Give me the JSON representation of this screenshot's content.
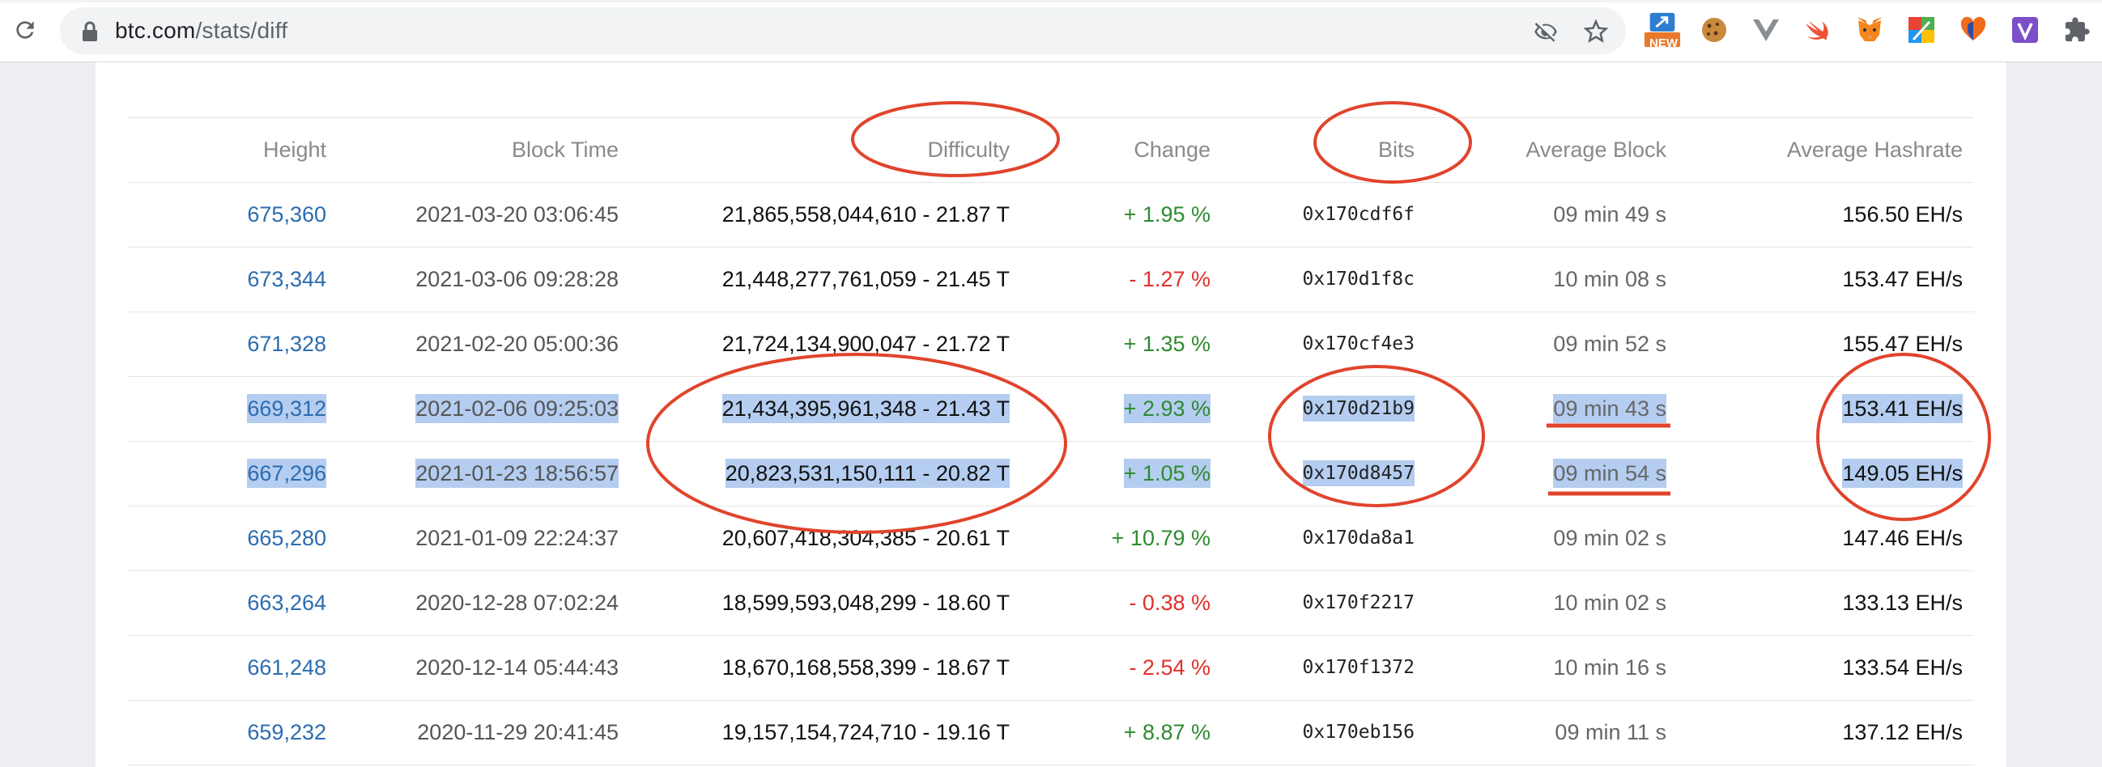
{
  "browser": {
    "url_host": "btc.com",
    "url_path": "/stats/diff",
    "ext_new_badge": "NEW"
  },
  "table": {
    "headers": {
      "height": "Height",
      "block_time": "Block Time",
      "difficulty": "Difficulty",
      "change": "Change",
      "bits": "Bits",
      "average_block": "Average Block",
      "average_hashrate": "Average Hashrate"
    },
    "rows": [
      {
        "height": "675,360",
        "time": "2021-03-20 03:06:45",
        "difficulty": "21,865,558,044,610 - 21.87 T",
        "change": "+ 1.95 %",
        "change_dir": "pos",
        "bits": "0x170cdf6f",
        "avg_block": "09 min 49 s",
        "hashrate": "156.50 EH/s",
        "selected": false
      },
      {
        "height": "673,344",
        "time": "2021-03-06 09:28:28",
        "difficulty": "21,448,277,761,059 - 21.45 T",
        "change": "- 1.27 %",
        "change_dir": "neg",
        "bits": "0x170d1f8c",
        "avg_block": "10 min 08 s",
        "hashrate": "153.47 EH/s",
        "selected": false
      },
      {
        "height": "671,328",
        "time": "2021-02-20 05:00:36",
        "difficulty": "21,724,134,900,047 - 21.72 T",
        "change": "+ 1.35 %",
        "change_dir": "pos",
        "bits": "0x170cf4e3",
        "avg_block": "09 min 52 s",
        "hashrate": "155.47 EH/s",
        "selected": false
      },
      {
        "height": "669,312",
        "time": "2021-02-06 09:25:03",
        "difficulty": "21,434,395,961,348 - 21.43 T",
        "change": "+ 2.93 %",
        "change_dir": "pos",
        "bits": "0x170d21b9",
        "avg_block": "09 min 43 s",
        "hashrate": "153.41 EH/s",
        "selected": true
      },
      {
        "height": "667,296",
        "time": "2021-01-23 18:56:57",
        "difficulty": "20,823,531,150,111 - 20.82 T",
        "change": "+ 1.05 %",
        "change_dir": "pos",
        "bits": "0x170d8457",
        "avg_block": "09 min 54 s",
        "hashrate": "149.05 EH/s",
        "selected": true
      },
      {
        "height": "665,280",
        "time": "2021-01-09 22:24:37",
        "difficulty": "20,607,418,304,385 - 20.61 T",
        "change": "+ 10.79 %",
        "change_dir": "pos",
        "bits": "0x170da8a1",
        "avg_block": "09 min 02 s",
        "hashrate": "147.46 EH/s",
        "selected": false
      },
      {
        "height": "663,264",
        "time": "2020-12-28 07:02:24",
        "difficulty": "18,599,593,048,299 - 18.60 T",
        "change": "- 0.38 %",
        "change_dir": "neg",
        "bits": "0x170f2217",
        "avg_block": "10 min 02 s",
        "hashrate": "133.13 EH/s",
        "selected": false
      },
      {
        "height": "661,248",
        "time": "2020-12-14 05:44:43",
        "difficulty": "18,670,168,558,399 - 18.67 T",
        "change": "- 2.54 %",
        "change_dir": "neg",
        "bits": "0x170f1372",
        "avg_block": "10 min 16 s",
        "hashrate": "133.54 EH/s",
        "selected": false
      },
      {
        "height": "659,232",
        "time": "2020-11-29 20:41:45",
        "difficulty": "19,157,154,724,710 - 19.16 T",
        "change": "+ 8.87 %",
        "change_dir": "pos",
        "bits": "0x170eb156",
        "avg_block": "09 min 11 s",
        "hashrate": "137.12 EH/s",
        "selected": false
      }
    ]
  },
  "colors": {
    "link": "#2b6cb0",
    "positive": "#2f8a2f",
    "negative": "#e0312b",
    "selection": "#b4cdf0",
    "annotation": "#e0442c"
  }
}
